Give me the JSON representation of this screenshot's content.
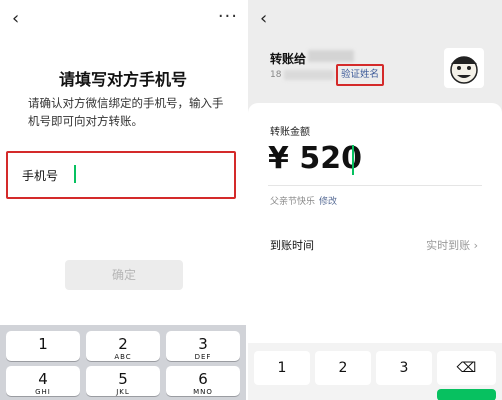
{
  "left": {
    "nav": {
      "back": "‹",
      "more": "···"
    },
    "title": "请填写对方手机号",
    "description": "请确认对方微信绑定的手机号，输入手机号即可向对方转账。",
    "phone_field": {
      "label": "手机号",
      "value": ""
    },
    "confirm_button": "确定",
    "keypad": [
      {
        "num": "1",
        "letters": ""
      },
      {
        "num": "2",
        "letters": "ABC"
      },
      {
        "num": "3",
        "letters": "DEF"
      },
      {
        "num": "4",
        "letters": "GHI"
      },
      {
        "num": "5",
        "letters": "JKL"
      },
      {
        "num": "6",
        "letters": "MNO"
      }
    ]
  },
  "right": {
    "nav": {
      "back": "‹"
    },
    "payee_label": "转账给",
    "account_prefix": "18",
    "verify_name": "验证姓名",
    "amount_label": "转账金额",
    "amount": "¥ 520",
    "remark": "父亲节快乐",
    "remark_edit": "修改",
    "arrival_label": "到账时间",
    "arrival_value": "实时到账 ›",
    "keypad": [
      "1",
      "2",
      "3",
      "⌫"
    ]
  },
  "colors": {
    "accent_red": "#d42a2a",
    "wechat_green": "#07c160",
    "link_blue": "#576b95"
  }
}
